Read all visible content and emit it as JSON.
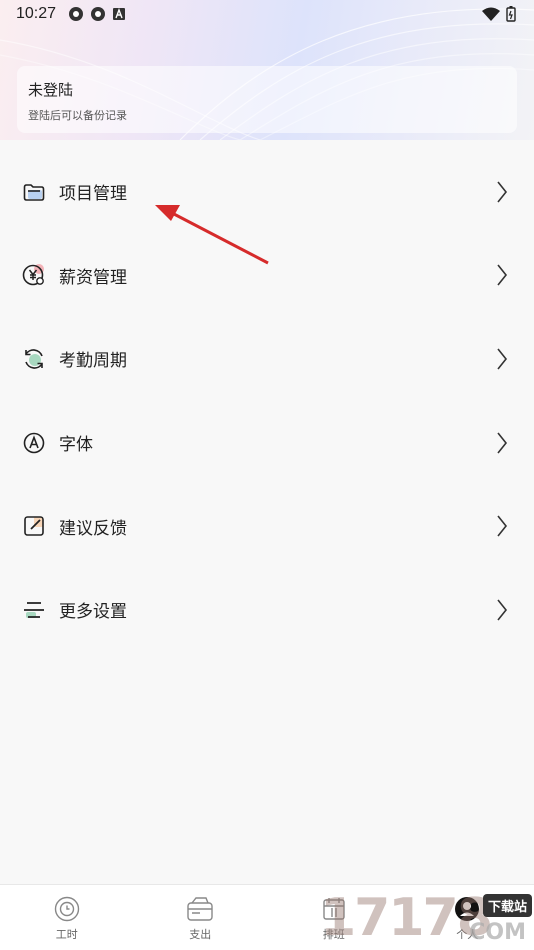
{
  "status_bar": {
    "time": "10:27"
  },
  "profile": {
    "title": "未登陆",
    "subtitle": "登陆后可以备份记录"
  },
  "menu": {
    "items": [
      {
        "label": "项目管理",
        "icon": "folder-icon"
      },
      {
        "label": "薪资管理",
        "icon": "salary-icon"
      },
      {
        "label": "考勤周期",
        "icon": "cycle-icon"
      },
      {
        "label": "字体",
        "icon": "font-icon"
      },
      {
        "label": "建议反馈",
        "icon": "feedback-icon"
      },
      {
        "label": "更多设置",
        "icon": "settings-list-icon"
      }
    ]
  },
  "tabbar": {
    "tabs": [
      {
        "label": "工时",
        "icon": "clock-icon"
      },
      {
        "label": "支出",
        "icon": "wallet-icon"
      },
      {
        "label": "排班",
        "icon": "calendar-icon"
      },
      {
        "label": "个人",
        "icon": "person-icon"
      }
    ]
  },
  "watermark": {
    "number": "17178",
    "badge": "下载站",
    "suffix": "COM"
  },
  "colors": {
    "accent_red": "#d62b2b",
    "icon_pink": "#f3b3b8",
    "icon_green": "#a8d8c0",
    "icon_blue": "#b8d0f0"
  }
}
